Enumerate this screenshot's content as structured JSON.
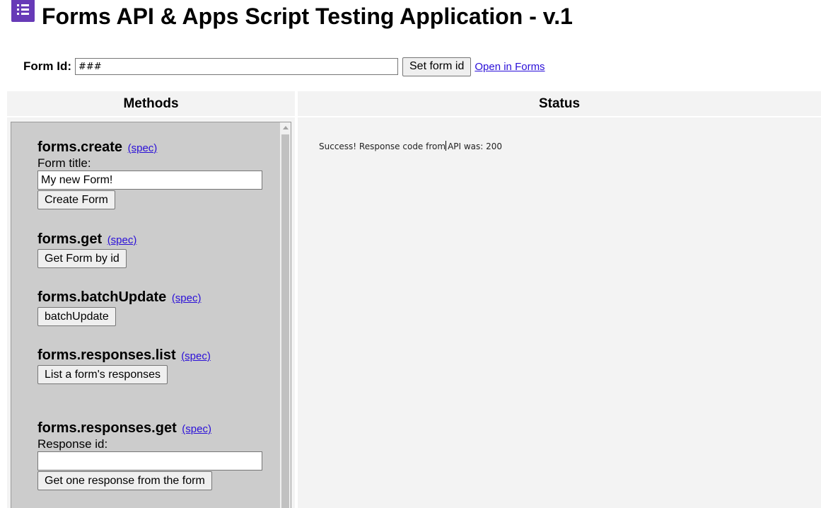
{
  "header": {
    "title": "Forms API & Apps Script Testing Application - v.1",
    "icon": "forms-list-icon",
    "icon_color": "#673ab7"
  },
  "form_id": {
    "label": "Form Id:",
    "value": "###",
    "set_button_label": "Set form id",
    "open_link_label": "Open in Forms"
  },
  "columns": {
    "methods_heading": "Methods",
    "status_heading": "Status"
  },
  "methods": {
    "spec_link_label": "(spec)",
    "create": {
      "name": "forms.create",
      "field_label": "Form title:",
      "field_value": "My new Form!",
      "button_label": "Create Form"
    },
    "get": {
      "name": "forms.get",
      "button_label": "Get Form by id"
    },
    "batch_update": {
      "name": "forms.batchUpdate",
      "button_label": "batchUpdate"
    },
    "responses_list": {
      "name": "forms.responses.list",
      "button_label": "List a form's responses"
    },
    "responses_get": {
      "name": "forms.responses.get",
      "field_label": "Response id:",
      "field_value": "",
      "button_label": "Get one response from the form"
    }
  },
  "status": {
    "message_before_caret": "Success! Response code from",
    "message_after_caret": "API was: 200"
  },
  "colors": {
    "panel_background": "#cccccc",
    "column_background": "#f3f3f3",
    "link": "#2a0fd8"
  }
}
